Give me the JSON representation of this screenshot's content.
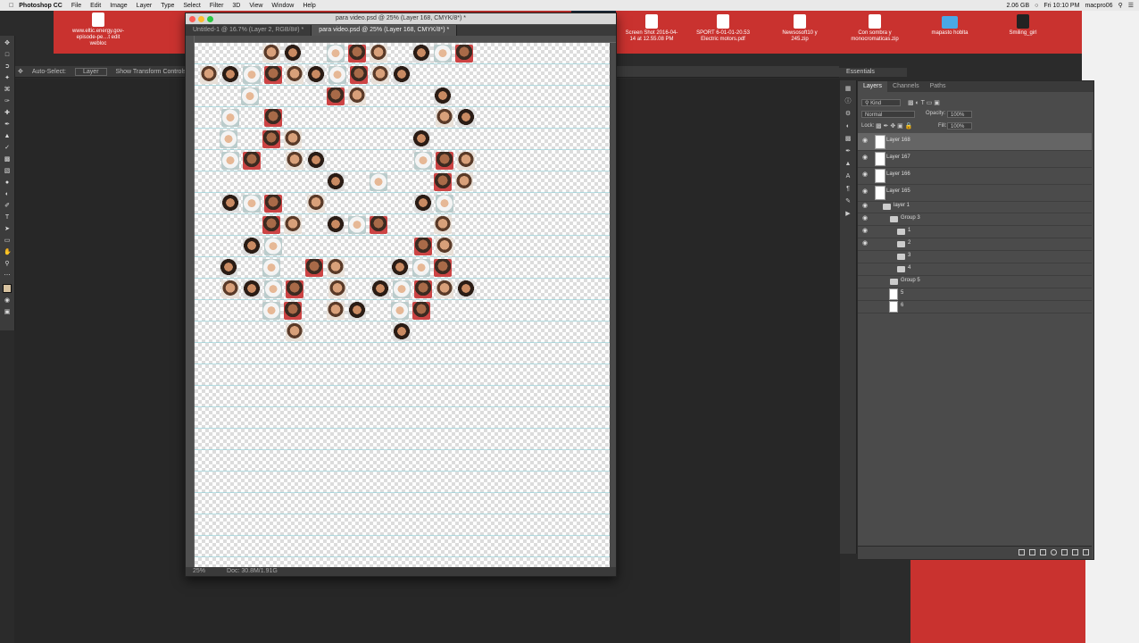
{
  "menubar": {
    "app_name": "Photoshop CC",
    "items": [
      "File",
      "Edit",
      "Image",
      "Layer",
      "Type",
      "Select",
      "Filter",
      "3D",
      "View",
      "Window",
      "Help"
    ],
    "status": [
      "2.06 GB",
      "Fri 10:10 PM",
      "macpro06"
    ]
  },
  "desktop": {
    "icons": [
      {
        "label": "www.eltic.energy.gov-episode-pe…t edit webloc"
      },
      {
        "label": "Screen Shot 2016-04-14 at 12.55.08 PM"
      },
      {
        "label": "SPORT 6-01-01-20.53 Electric motors.pdf"
      },
      {
        "label": "Newsosoft10 y 245.zip"
      },
      {
        "label": "Con sombra y monocromaticas.zip"
      },
      {
        "label": "mapasto hoblta"
      },
      {
        "label": "Smiling_girl"
      }
    ]
  },
  "options_bar": {
    "auto_select_label": "Auto-Select:",
    "auto_select_value": "Layer",
    "transform_label": "Show Transform Controls"
  },
  "document": {
    "window_title": "para video.psd @ 25% (Layer 168, CMYK/8*) *",
    "tabs": [
      {
        "label": "Untitled-1 @ 16.7% (Layer 2, RGB/8#) *",
        "active": false
      },
      {
        "label": "para video.psd @ 25% (Layer 168, CMYK/8*) *",
        "active": true
      }
    ],
    "zoom": "25%",
    "doc_size": "Doc: 30.8M/1.91G"
  },
  "workspace": {
    "label": "Essentials"
  },
  "layers_panel": {
    "tabs": [
      {
        "label": "Layers",
        "active": true
      },
      {
        "label": "Channels",
        "active": false
      },
      {
        "label": "Paths",
        "active": false
      }
    ],
    "filter_kind": "Kind",
    "blend_mode": "Normal",
    "opacity_label": "Opacity:",
    "opacity_value": "100%",
    "lock_label": "Lock:",
    "fill_label": "Fill:",
    "fill_value": "100%",
    "layers": [
      {
        "name": "Layer 168",
        "type": "layer",
        "indent": 0,
        "selected": true,
        "visible": true
      },
      {
        "name": "Layer 167",
        "type": "layer",
        "indent": 0,
        "selected": false,
        "visible": true
      },
      {
        "name": "Layer 166",
        "type": "layer",
        "indent": 0,
        "selected": false,
        "visible": true
      },
      {
        "name": "Layer 165",
        "type": "layer",
        "indent": 0,
        "selected": false,
        "visible": true
      },
      {
        "name": "layer 1",
        "type": "group",
        "indent": 0,
        "selected": false,
        "visible": true
      },
      {
        "name": "Group 3",
        "type": "group",
        "indent": 1,
        "selected": false,
        "visible": true
      },
      {
        "name": "1",
        "type": "group",
        "indent": 2,
        "selected": false,
        "visible": true
      },
      {
        "name": "2",
        "type": "group",
        "indent": 2,
        "selected": false,
        "visible": true
      },
      {
        "name": "3",
        "type": "group",
        "indent": 2,
        "selected": false,
        "visible": false
      },
      {
        "name": "4",
        "type": "group",
        "indent": 2,
        "selected": false,
        "visible": false
      },
      {
        "name": "Group 5",
        "type": "group",
        "indent": 1,
        "selected": false,
        "visible": false
      },
      {
        "name": "5",
        "type": "layer",
        "indent": 2,
        "selected": false,
        "visible": false
      },
      {
        "name": "6",
        "type": "layer",
        "indent": 2,
        "selected": false,
        "visible": false
      }
    ]
  }
}
